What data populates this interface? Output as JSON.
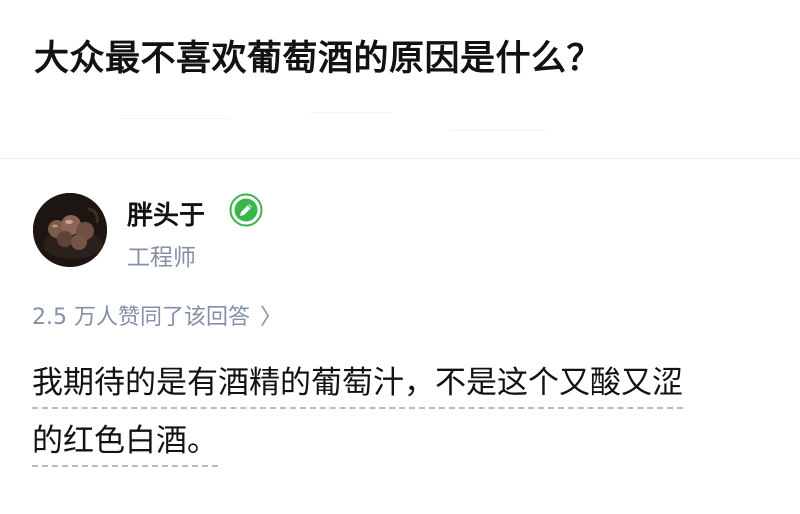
{
  "question": {
    "title": "大众最不喜欢葡萄酒的原因是什么？"
  },
  "author": {
    "avatar_icon": "avatar-photo",
    "name": "胖头于",
    "badge_icon": "pencil-badge-icon",
    "badge_color": "#39b54a",
    "title": "工程师"
  },
  "vote": {
    "text": "2.5 万人赞同了该回答",
    "chevron_icon": "chevron-right-icon",
    "chevron": "〉"
  },
  "answer": {
    "line1": "我期待的是有酒精的葡萄汁，不是这个又酸又涩",
    "line2": "的红色白酒。"
  }
}
